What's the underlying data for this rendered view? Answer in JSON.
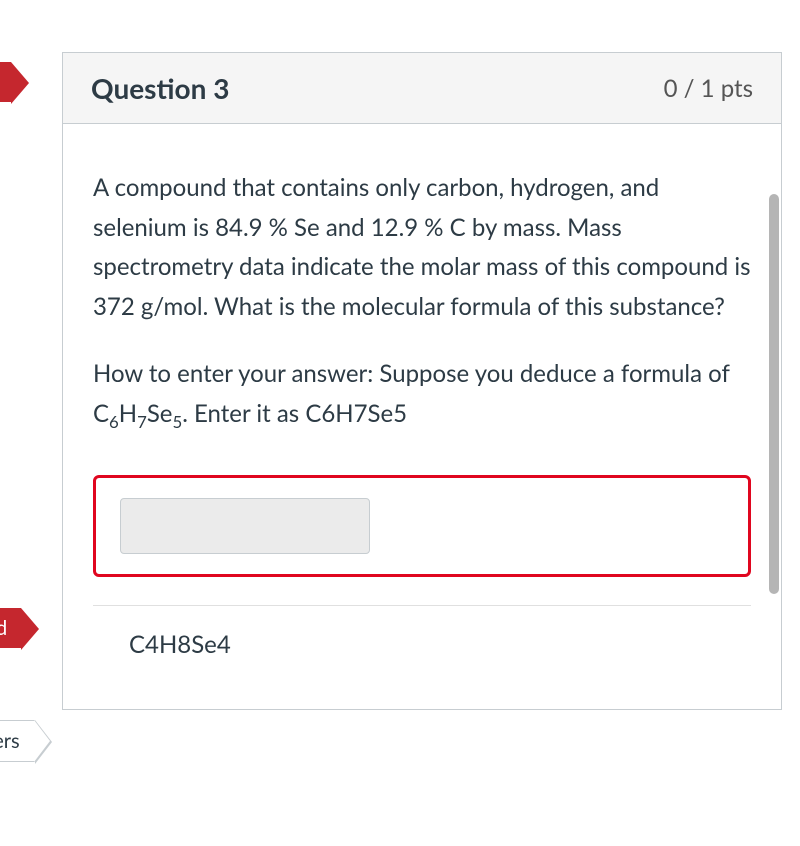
{
  "flags": {
    "flag1": "red",
    "flag2": "ered",
    "flag3": "swers"
  },
  "header": {
    "title": "Question 3",
    "points": "0 / 1 pts"
  },
  "body": {
    "prompt": "A compound that contains only carbon, hydrogen, and selenium is 84.9 % Se and 12.9 % C by mass. Mass spectrometry data indicate the molar mass of this compound is 372 g/mol. What is the molecular formula of this substance?",
    "instructions_prefix": "How to enter your answer:  Suppose you deduce a formula of C",
    "instructions_sub1": "6",
    "instructions_mid1": "H",
    "instructions_sub2": "7",
    "instructions_mid2": "Se",
    "instructions_sub3": "5",
    "instructions_suffix": ".  Enter it as C6H7Se5"
  },
  "answer": {
    "input_value": "",
    "submitted": "C4H8Se4"
  }
}
